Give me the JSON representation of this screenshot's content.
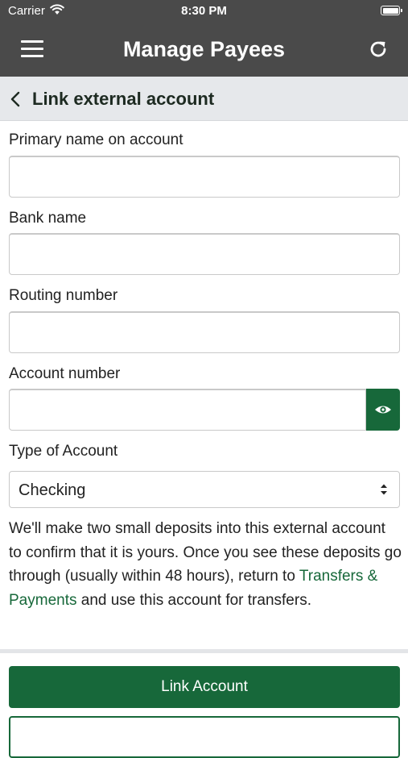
{
  "status_bar": {
    "carrier": "Carrier",
    "time": "8:30 PM"
  },
  "header": {
    "title": "Manage Payees",
    "menu_icon": "hamburger-menu-icon",
    "refresh_icon": "refresh-icon"
  },
  "subheader": {
    "title": "Link external account",
    "back_icon": "chevron-left-icon"
  },
  "form": {
    "primary_name_label": "Primary name on account",
    "primary_name_value": "",
    "bank_name_label": "Bank name",
    "bank_name_value": "",
    "routing_number_label": "Routing number",
    "routing_number_value": "",
    "account_number_label": "Account number",
    "account_number_value": "",
    "type_label": "Type of Account",
    "type_value": "Checking"
  },
  "info": {
    "text_before": "We'll make two small deposits into this external account to confirm that it is yours. Once you see these deposits go through (usually within 48 hours), return to ",
    "link_text": "Transfers & Payments",
    "text_after": " and use this account for transfers."
  },
  "actions": {
    "link_account_label": "Link Account"
  },
  "colors": {
    "header_bg": "#4a4a4a",
    "accent_green": "#17683a",
    "subheader_bg": "#e6e8eb"
  }
}
